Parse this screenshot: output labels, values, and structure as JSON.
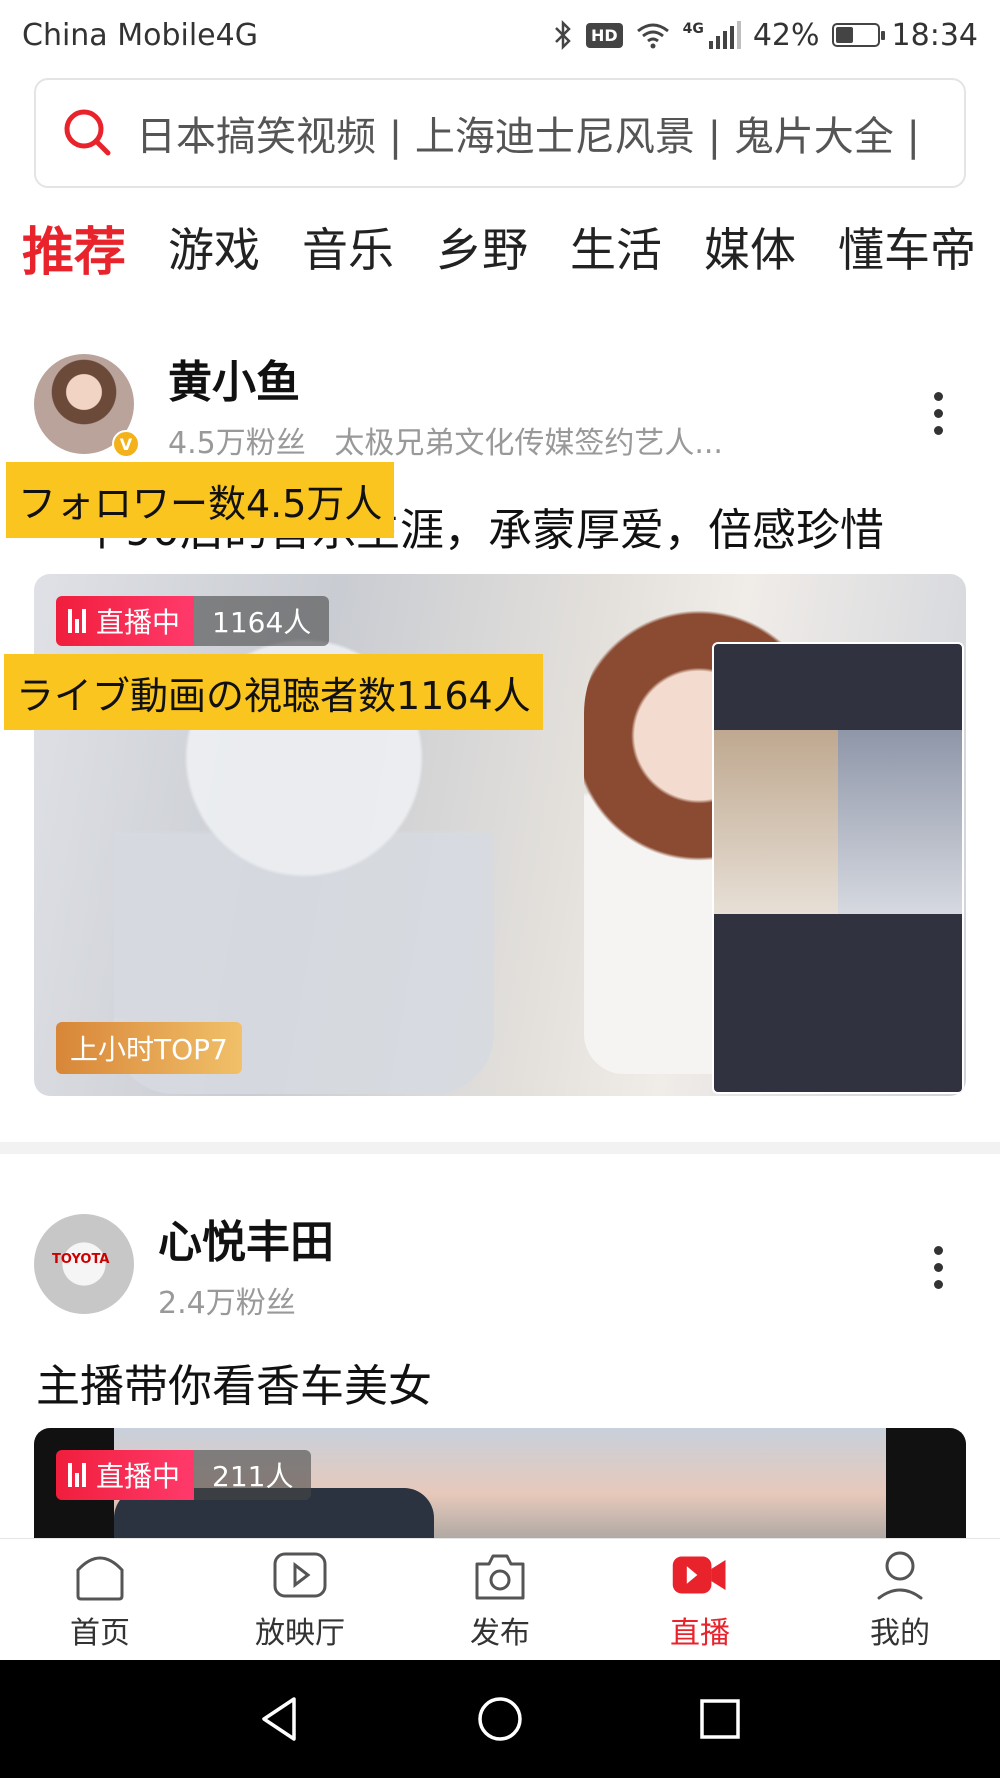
{
  "status_bar": {
    "carrier": "China Mobile4G",
    "hd": "HD",
    "network": "4G",
    "battery": "42%",
    "battery_level": 0.42,
    "time": "18:34",
    "icons": [
      "bluetooth-icon",
      "hd-icon",
      "wifi-icon",
      "signal-icon",
      "battery-icon"
    ]
  },
  "search": {
    "placeholder": "日本搞笑视频 | 上海迪士尼风景 | 鬼片大全 |"
  },
  "tabs": [
    {
      "label": "推荐",
      "active": true
    },
    {
      "label": "游戏"
    },
    {
      "label": "音乐"
    },
    {
      "label": "乡野"
    },
    {
      "label": "生活"
    },
    {
      "label": "媒体"
    },
    {
      "label": "懂车帝"
    }
  ],
  "posts": [
    {
      "user_name": "黄小鱼",
      "followers": "4.5万粉丝",
      "bio": "太极兄弟文化传媒签约艺人...",
      "verified": "V",
      "title": "一个90后的音乐生涯，承蒙厚爱，倍感珍惜",
      "live_label": "直播中",
      "viewers": "1164人",
      "rank_badge": "上小时TOP7"
    },
    {
      "user_name": "心悦丰田",
      "followers": "2.4万粉丝",
      "title": "主播带你看香车美女",
      "live_label": "直播中",
      "viewers": "211人"
    }
  ],
  "annotations": {
    "followers_note": "フォロワー数4.5万人",
    "viewers_note": "ライブ動画の視聴者数1164人"
  },
  "bottom_nav": [
    {
      "label": "首页",
      "icon": "home-icon"
    },
    {
      "label": "放映厅",
      "icon": "play-icon"
    },
    {
      "label": "发布",
      "icon": "camera-icon"
    },
    {
      "label": "直播",
      "icon": "live-video-icon",
      "active": true
    },
    {
      "label": "我的",
      "icon": "profile-icon"
    }
  ],
  "system_nav": [
    "back-icon",
    "home-circle-icon",
    "recents-icon"
  ],
  "colors": {
    "accent": "#e8232c",
    "annotation": "#fbc51f",
    "live": "#f01e3c"
  }
}
